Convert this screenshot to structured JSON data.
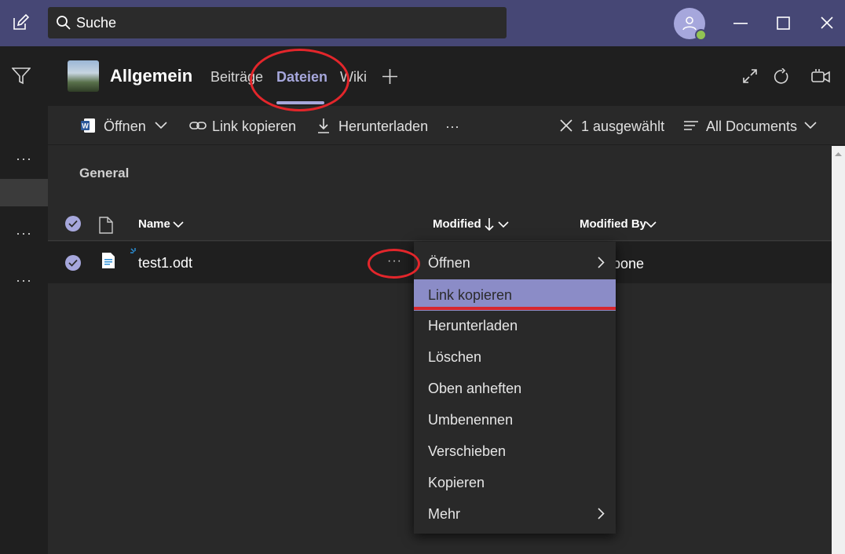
{
  "titlebar": {
    "search_placeholder": "Suche",
    "icons": [
      "compose-icon",
      "search-icon",
      "avatar",
      "minimize-icon",
      "maximize-icon",
      "close-icon"
    ],
    "presence_color": "#92c353"
  },
  "rail": {
    "dots": "···"
  },
  "channel": {
    "title": "Allgemein",
    "tabs": [
      {
        "label": "Beiträge",
        "active": false
      },
      {
        "label": "Dateien",
        "active": true
      },
      {
        "label": "Wiki",
        "active": false
      }
    ],
    "add_tab": "+"
  },
  "toolbar": {
    "open_label": "Öffnen",
    "copy_link_label": "Link kopieren",
    "download_label": "Herunterladen",
    "more_label": "···",
    "selected_label": "1 ausgewählt",
    "view_label": "All Documents"
  },
  "list": {
    "section_title": "General",
    "columns": {
      "name": "Name",
      "modified": "Modified",
      "modified_by": "Modified By"
    },
    "rows": [
      {
        "name": "test1.odt",
        "more": "···",
        "modified_by_visible": "pone"
      }
    ]
  },
  "context_menu": {
    "items": [
      {
        "label": "Öffnen",
        "submenu": true
      },
      {
        "label": "Link kopieren",
        "submenu": false,
        "highlighted": true
      },
      {
        "label": "Herunterladen",
        "submenu": false
      },
      {
        "label": "Löschen",
        "submenu": false
      },
      {
        "label": "Oben anheften",
        "submenu": false
      },
      {
        "label": "Umbenennen",
        "submenu": false
      },
      {
        "label": "Verschieben",
        "submenu": false
      },
      {
        "label": "Kopieren",
        "submenu": false
      },
      {
        "label": "Mehr",
        "submenu": true
      }
    ]
  },
  "colors": {
    "titlebar": "#464775",
    "accent": "#a6a7dc",
    "menu_highlight": "#8b8cc7",
    "annotation": "#e3262b"
  }
}
